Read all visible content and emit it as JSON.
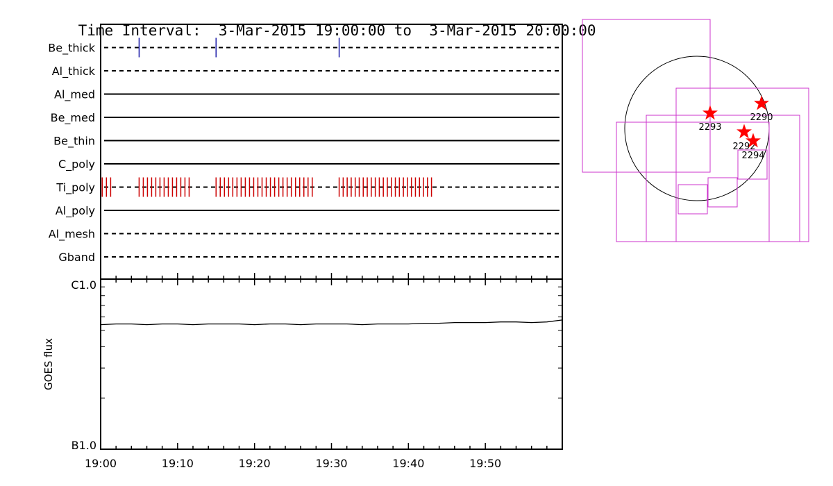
{
  "header": {
    "label": "Time Interval:",
    "start": "3-Mar-2015 19:00:00",
    "to": "to",
    "end": "3-Mar-2015 20:00:00"
  },
  "chart_data": [
    {
      "type": "scatter",
      "description_of_kind": "event timeline per filter",
      "x_domain_minutes": [
        0,
        60
      ],
      "x_tick_labels": [
        "19:00",
        "19:10",
        "19:20",
        "19:30",
        "19:40",
        "19:50"
      ],
      "rows": [
        {
          "name": "Be_thick",
          "style": "dashed",
          "marks": [
            5,
            15,
            31
          ],
          "mark_color": "#1a1aa8"
        },
        {
          "name": "Al_thick",
          "style": "dashed",
          "marks": []
        },
        {
          "name": "Al_med",
          "style": "solid",
          "marks": []
        },
        {
          "name": "Be_med",
          "style": "solid",
          "marks": []
        },
        {
          "name": "Be_thin",
          "style": "solid",
          "marks": []
        },
        {
          "name": "C_poly",
          "style": "solid",
          "marks": []
        },
        {
          "name": "Ti_poly",
          "style": "dashed",
          "mark_color": "#cc0000",
          "mark_runs": [
            {
              "start": 0.2,
              "end": 1.3,
              "count": 3
            },
            {
              "start": 5.0,
              "end": 11.5,
              "count": 13
            },
            {
              "start": 15.0,
              "end": 27.5,
              "count": 24
            },
            {
              "start": 31.0,
              "end": 43.0,
              "count": 24
            }
          ]
        },
        {
          "name": "Al_poly",
          "style": "solid",
          "marks": []
        },
        {
          "name": "Al_mesh",
          "style": "dashed",
          "marks": []
        },
        {
          "name": "Gband",
          "style": "dashed",
          "marks": []
        }
      ]
    },
    {
      "type": "line",
      "ylabel": "GOES flux",
      "yscale": "log",
      "y_tick_labels": [
        "C1.0",
        "B1.0"
      ],
      "ylim": [
        1e-07,
        1e-06
      ],
      "x_tick_labels": [
        "19:00",
        "19:10",
        "19:20",
        "19:30",
        "19:40",
        "19:50"
      ],
      "series": [
        {
          "values_x_minutes": [
            0,
            2,
            4,
            6,
            8,
            10,
            12,
            14,
            16,
            18,
            20,
            22,
            24,
            26,
            28,
            30,
            32,
            34,
            36,
            38,
            40,
            42,
            44,
            46,
            48,
            50,
            52,
            54,
            56,
            58,
            60
          ],
          "values_y": [
            5.4e-07,
            5.45e-07,
            5.45e-07,
            5.4e-07,
            5.45e-07,
            5.45e-07,
            5.4e-07,
            5.45e-07,
            5.45e-07,
            5.45e-07,
            5.4e-07,
            5.45e-07,
            5.45e-07,
            5.4e-07,
            5.45e-07,
            5.45e-07,
            5.45e-07,
            5.4e-07,
            5.45e-07,
            5.45e-07,
            5.45e-07,
            5.5e-07,
            5.5e-07,
            5.55e-07,
            5.55e-07,
            5.55e-07,
            5.6e-07,
            5.6e-07,
            5.55e-07,
            5.6e-07,
            5.75e-07
          ],
          "color": "#000000"
        }
      ]
    }
  ],
  "map": {
    "sun_circle": true,
    "box_color": "#cc33cc",
    "star_color": "#ff0000",
    "active_regions": [
      {
        "label": "2293"
      },
      {
        "label": "2290"
      },
      {
        "label": "2292"
      },
      {
        "label": "2294"
      }
    ]
  }
}
